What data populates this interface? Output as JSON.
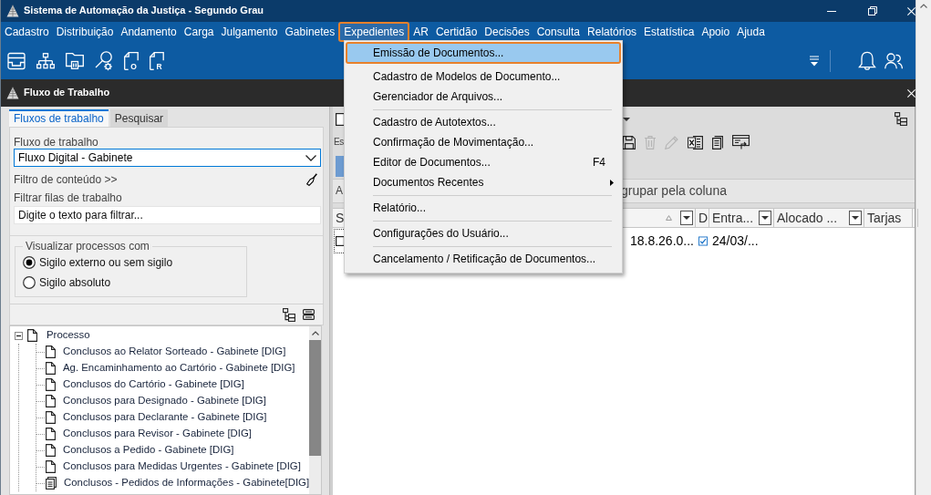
{
  "window": {
    "title": "Sistema de Automação da Justiça - Segundo Grau"
  },
  "menu_bar": [
    {
      "label": "Cadastro",
      "selected": false
    },
    {
      "label": "Distribuição",
      "selected": false
    },
    {
      "label": "Andamento",
      "selected": false
    },
    {
      "label": "Carga",
      "selected": false
    },
    {
      "label": "Julgamento",
      "selected": false
    },
    {
      "label": "Gabinetes",
      "selected": false
    },
    {
      "label": "Expedientes",
      "selected": true
    },
    {
      "label": "AR",
      "selected": false
    },
    {
      "label": "Certidão",
      "selected": false
    },
    {
      "label": "Decisões",
      "selected": false
    },
    {
      "label": "Consulta",
      "selected": false
    },
    {
      "label": "Relatórios",
      "selected": false
    },
    {
      "label": "Estatística",
      "selected": false
    },
    {
      "label": "Apoio",
      "selected": false
    },
    {
      "label": "Ajuda",
      "selected": false
    }
  ],
  "toolbar": {
    "tools": [
      {
        "kind": "tray"
      },
      {
        "kind": "hierarchy"
      },
      {
        "kind": "folder"
      },
      {
        "kind": "search-settings"
      },
      {
        "kind": "document-letter",
        "letter": "O"
      },
      {
        "kind": "document-letter",
        "letter": "R"
      }
    ],
    "right_tools": [
      {
        "kind": "filter"
      },
      {
        "kind": "bell"
      },
      {
        "kind": "users"
      }
    ]
  },
  "panel": {
    "title": "Fluxo de Trabalho"
  },
  "left_panel": {
    "tabs": [
      {
        "label": "Fluxos de trabalho",
        "selected": true
      },
      {
        "label": "Pesquisar",
        "selected": false
      }
    ],
    "workflow": {
      "label": "Fluxo de trabalho",
      "value": "Fluxo Digital - Gabinete"
    },
    "content_filter": {
      "label": "Filtro de conteúdo >>"
    },
    "queue_filter": {
      "label": "Filtrar filas de trabalho",
      "placeholder": "Digite o texto para filtrar..."
    },
    "secrecy": {
      "legend": "Visualizar processos com",
      "options": [
        {
          "label": "Sigilo externo ou sem sigilo",
          "selected": true
        },
        {
          "label": "Sigilo absoluto",
          "selected": false
        }
      ]
    },
    "tree": {
      "items": [
        {
          "label": "Processo",
          "kind": "document",
          "expanded": true,
          "children": [
            {
              "label": "Conclusos ao Relator Sorteado - Gabinete [DIG]",
              "kind": "document"
            },
            {
              "label": "Ag. Encaminhamento ao Cartório - Gabinete [DIG]",
              "kind": "document"
            },
            {
              "label": "Conclusos do Cartório - Gabinete [DIG]",
              "kind": "document"
            },
            {
              "label": "Conclusos para Designado - Gabinete [DIG]",
              "kind": "document"
            },
            {
              "label": "Conclusos para Declarante - Gabinete [DIG]",
              "kind": "document"
            },
            {
              "label": "Conclusos para Revisor - Gabinete [DIG]",
              "kind": "document"
            },
            {
              "label": "Conclusos a Pedido - Gabinete [DIG]",
              "kind": "document"
            },
            {
              "label": "Conclusos para Medidas Urgentes - Gabinete [DIG]",
              "kind": "document"
            },
            {
              "label": "Conclusos - Pedidos de Informações - Gabinete[DIG]",
              "kind": "documents"
            }
          ]
        }
      ]
    }
  },
  "work_area": {
    "toolbar_label": "Es",
    "tools": [
      {
        "kind": "save",
        "disabled": false
      },
      {
        "kind": "trash",
        "disabled": true
      },
      {
        "kind": "pencil",
        "disabled": true
      },
      {
        "kind": "spreadsheet",
        "disabled": false
      },
      {
        "kind": "document",
        "disabled": false
      },
      {
        "kind": "export",
        "disabled": false
      }
    ],
    "group_panel": {
      "text_start": "A",
      "text_end": "grupar pela coluna"
    },
    "columns": [
      {
        "label": "S",
        "sorted": true,
        "filter": true
      },
      {
        "label": "D",
        "sorted": false,
        "filter": false
      },
      {
        "label": "Entra...",
        "sorted": false,
        "filter": true
      },
      {
        "label": "Alocado ...",
        "sorted": false,
        "filter": true
      },
      {
        "label": "Tarjas",
        "sorted": false,
        "filter": false
      }
    ],
    "rows": [
      {
        "checked": false,
        "cells": [
          {
            "kind": "text",
            "text": "18.8.26.0..."
          },
          {
            "kind": "check",
            "checked": true
          },
          {
            "kind": "text",
            "text": "24/03/..."
          }
        ]
      }
    ]
  },
  "dropdown_menu": {
    "items": [
      {
        "kind": "item",
        "label": "Emissão de Documentos...",
        "selected": true,
        "submenu": false
      },
      {
        "kind": "item",
        "label": "Cadastro de Modelos de Documento...",
        "selected": false,
        "submenu": false
      },
      {
        "kind": "item",
        "label": "Gerenciador de Arquivos...",
        "selected": false,
        "submenu": false
      },
      {
        "kind": "separator"
      },
      {
        "kind": "item",
        "label": "Cadastro de Autotextos...",
        "selected": false,
        "submenu": false
      },
      {
        "kind": "item",
        "label": "Confirmação de Movimentação...",
        "selected": false,
        "submenu": false
      },
      {
        "kind": "item",
        "label": "Editor de Documentos...",
        "shortcut": "F4",
        "selected": false,
        "submenu": false
      },
      {
        "kind": "item",
        "label": "Documentos Recentes",
        "selected": false,
        "submenu": true
      },
      {
        "kind": "separator"
      },
      {
        "kind": "item",
        "label": "Relatório...",
        "selected": false,
        "submenu": false
      },
      {
        "kind": "separator"
      },
      {
        "kind": "item",
        "label": "Configurações do Usuário...",
        "selected": false,
        "submenu": false
      },
      {
        "kind": "separator"
      },
      {
        "kind": "item",
        "label": "Cancelamento / Retificação de Documentos...",
        "selected": false,
        "submenu": false
      }
    ]
  }
}
